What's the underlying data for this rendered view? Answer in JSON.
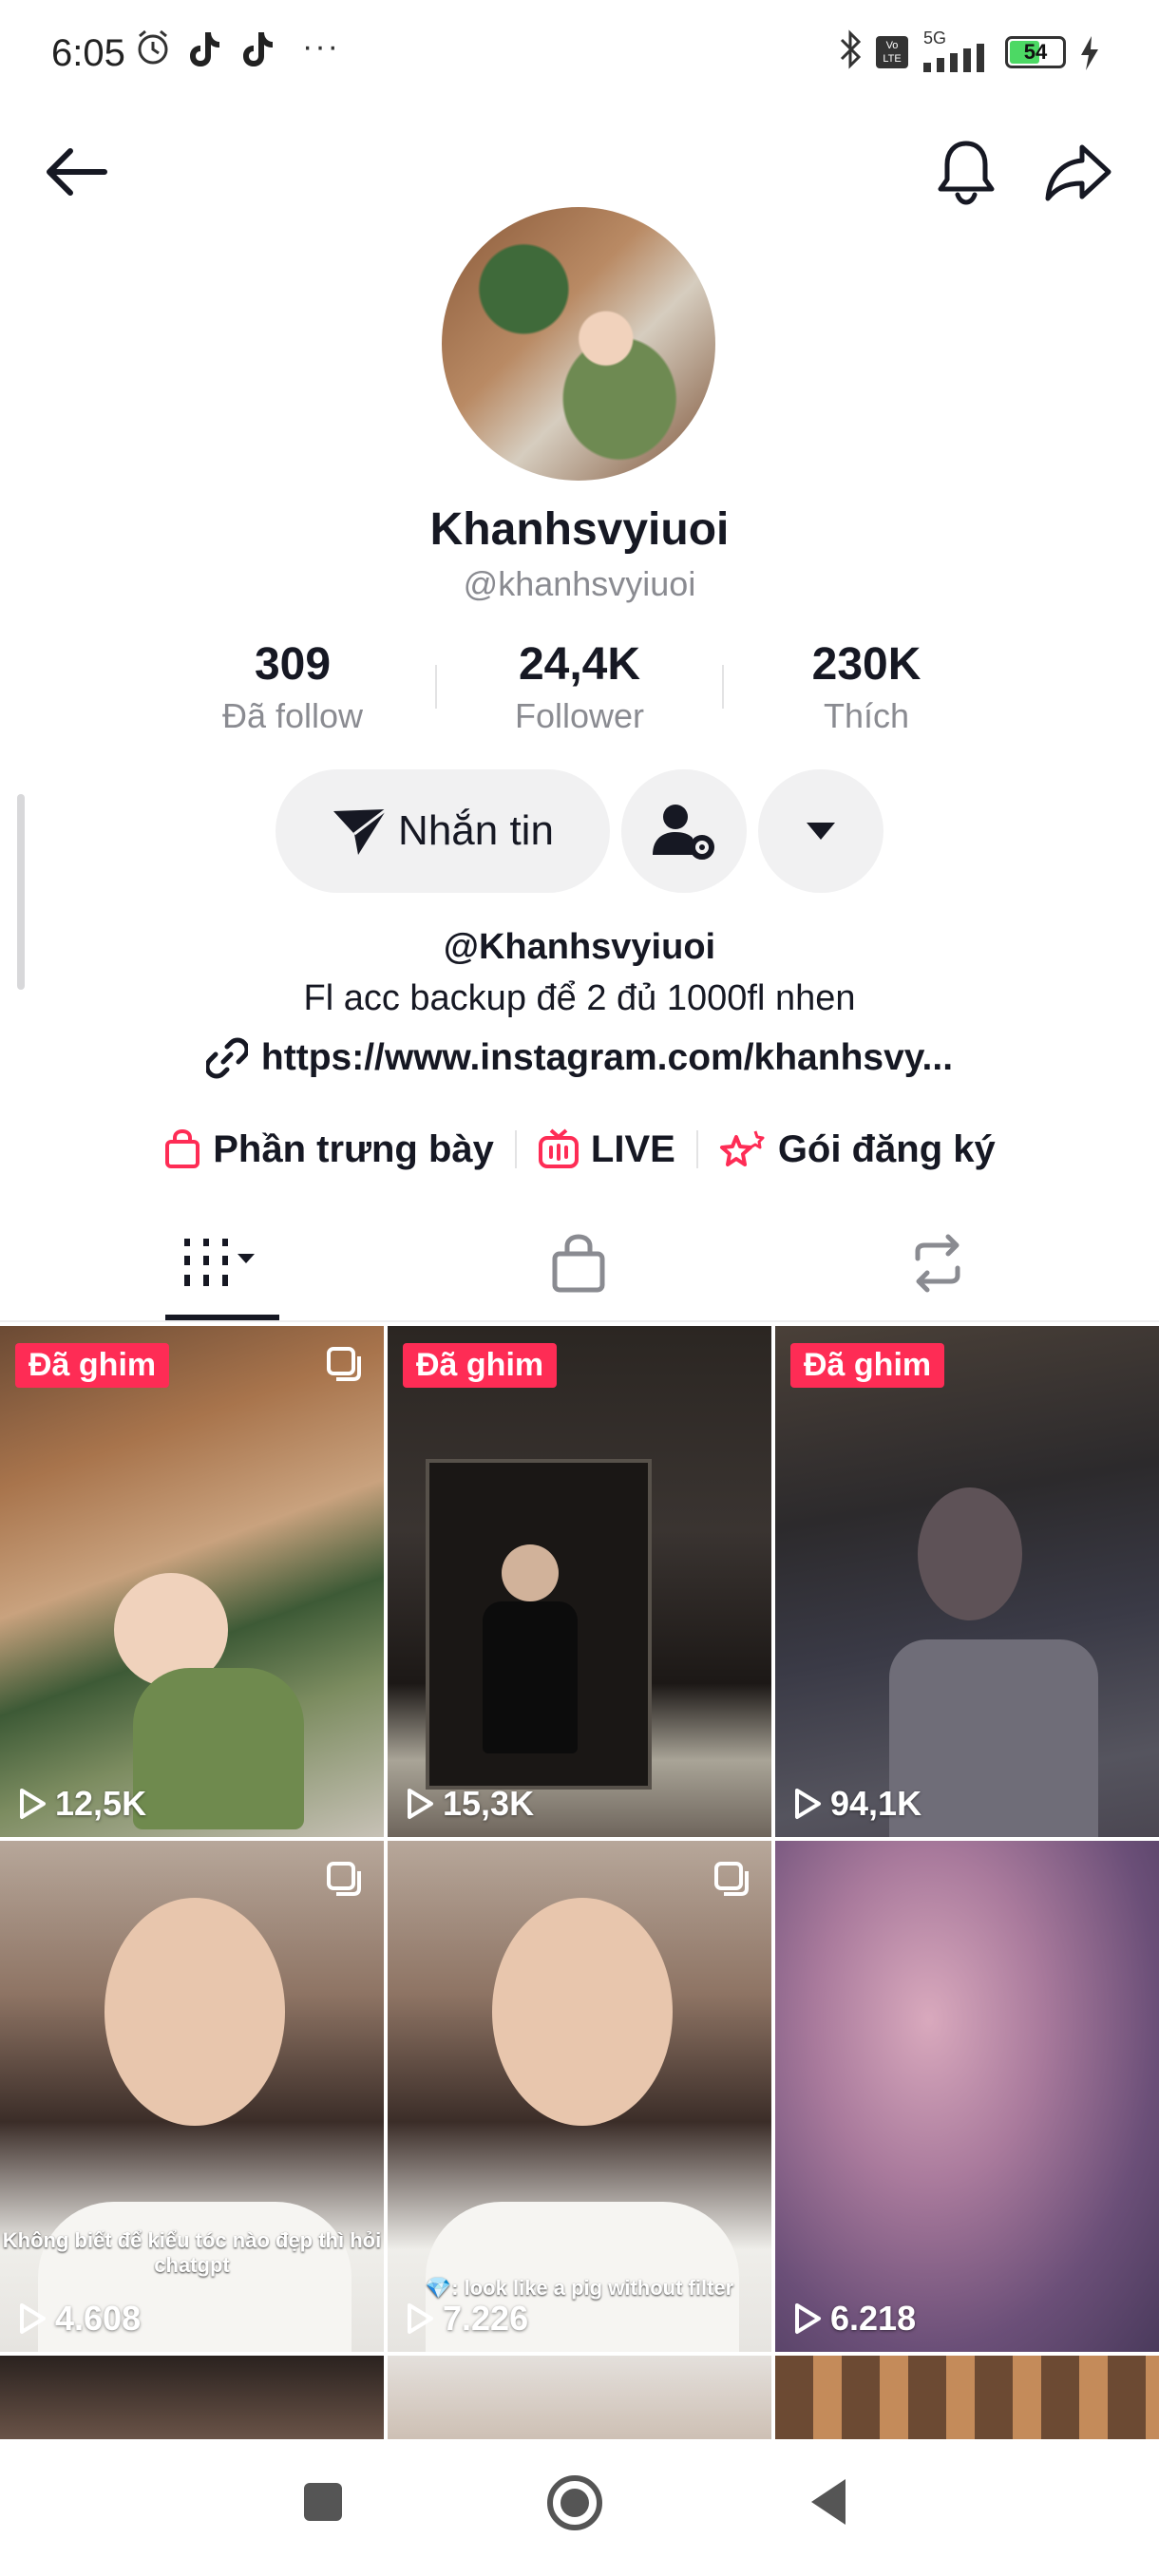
{
  "status_bar": {
    "time": "6:05",
    "network": "5G",
    "volte": "Vo LTE",
    "battery": "54",
    "more": "···"
  },
  "profile": {
    "display_name": "Khanhsvyiuoi",
    "username": "@khanhsvyiuoi",
    "stats": [
      {
        "value": "309",
        "label": "Đã follow"
      },
      {
        "value": "24,4K",
        "label": "Follower"
      },
      {
        "value": "230K",
        "label": "Thích"
      }
    ],
    "message_label": "Nhắn tin",
    "bio_handle": "@Khanhsvyiuoi",
    "bio_text": "Fl acc backup để 2 đủ 1000fl nhen",
    "bio_link": "https://www.instagram.com/khanhsvy..."
  },
  "entries": [
    {
      "label": "Phần trưng bày",
      "icon": "shopping-bag-icon"
    },
    {
      "label": "LIVE",
      "icon": "live-tv-icon"
    },
    {
      "label": "Gói đăng ký",
      "icon": "subscription-stars-icon"
    }
  ],
  "tabs": [
    {
      "name": "videos",
      "icon": "grid-icon",
      "active": true
    },
    {
      "name": "shop",
      "icon": "shopping-bag-icon",
      "active": false
    },
    {
      "name": "reposts",
      "icon": "repost-icon",
      "active": false
    }
  ],
  "videos": [
    {
      "pinned": "Đã ghim",
      "views": "12,5K",
      "multi": true,
      "caption": ""
    },
    {
      "pinned": "Đã ghim",
      "views": "15,3K",
      "multi": false,
      "caption": ""
    },
    {
      "pinned": "Đã ghim",
      "views": "94,1K",
      "multi": false,
      "caption": ""
    },
    {
      "pinned": "",
      "views": "4.608",
      "multi": true,
      "caption": "Không biết để kiểu tóc nào đẹp thì hỏi chatgpt"
    },
    {
      "pinned": "",
      "views": "7.226",
      "multi": true,
      "caption": "💎: look like a pig without filter"
    },
    {
      "pinned": "",
      "views": "6.218",
      "multi": false,
      "caption": ""
    }
  ],
  "colors": {
    "accent": "#fe2c55",
    "text": "#161823",
    "secondary": "#8a8b91",
    "pill": "#f1f1f2"
  }
}
